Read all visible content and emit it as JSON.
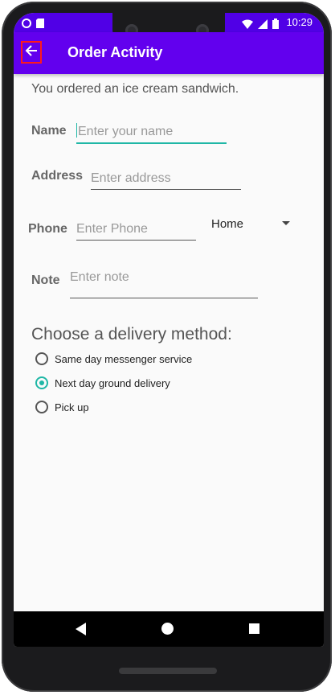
{
  "status_bar": {
    "time": "10:29",
    "left_icons": [
      "circle-app-icon",
      "sd-card-icon"
    ],
    "right_icons": [
      "wifi-icon",
      "signal-icon",
      "battery-icon"
    ]
  },
  "app_bar": {
    "title": "Order Activity",
    "back_icon": "arrow-left-icon",
    "color": "#6200ee"
  },
  "order": {
    "message": "You ordered an ice cream sandwich."
  },
  "form": {
    "name": {
      "label": "Name",
      "placeholder": "Enter your name",
      "value": ""
    },
    "address": {
      "label": "Address",
      "placeholder": "Enter address",
      "value": ""
    },
    "phone": {
      "label": "Phone",
      "placeholder": "Enter Phone",
      "value": ""
    },
    "phone_type": {
      "selected": "Home"
    },
    "note": {
      "label": "Note",
      "placeholder": "Enter note",
      "value": ""
    }
  },
  "delivery": {
    "heading": "Choose a delivery method:",
    "options": [
      {
        "label": "Same day messenger service",
        "checked": false
      },
      {
        "label": "Next day ground delivery",
        "checked": true
      },
      {
        "label": "Pick up",
        "checked": false
      }
    ]
  },
  "colors": {
    "accent": "#1fb7a6",
    "status_bar": "#5000e6"
  }
}
